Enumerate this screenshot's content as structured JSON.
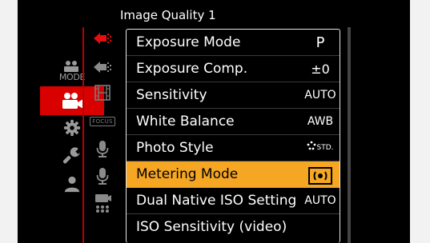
{
  "header": {
    "title": "Image Quality 1"
  },
  "main_menu": [
    {
      "id": "mode",
      "label": "MODE",
      "icon": "mode-icon",
      "selected": false
    },
    {
      "id": "video",
      "icon": "video-camera-icon",
      "selected": true
    },
    {
      "id": "custom",
      "icon": "gear-icon",
      "selected": false
    },
    {
      "id": "setup",
      "icon": "wrench-icon",
      "selected": false
    },
    {
      "id": "mymenu",
      "icon": "person-icon",
      "selected": false
    }
  ],
  "sub_tabs": [
    {
      "icon": "image-quality-tab-icon",
      "active": true
    },
    {
      "icon": "image-format-tab-icon",
      "active": false
    },
    {
      "icon": "film-strip-icon",
      "active": false
    },
    {
      "icon": "focus-tab-icon",
      "label": "FOCUS",
      "active": false
    },
    {
      "icon": "microphone-icon",
      "active": false
    },
    {
      "icon": "microphone-icon",
      "active": false
    },
    {
      "icon": "camera-tripod-icon",
      "active": false
    }
  ],
  "menu_items": [
    {
      "label": "Exposure Mode",
      "value": "P"
    },
    {
      "label": "Exposure Comp.",
      "value": "±0"
    },
    {
      "label": "Sensitivity",
      "value": "AUTO"
    },
    {
      "label": "White Balance",
      "value": "AWB"
    },
    {
      "label": "Photo Style",
      "value": "STD.",
      "value_icon": "photo-style-std-icon"
    },
    {
      "label": "Metering Mode",
      "value_icon": "metering-multiple-icon",
      "selected": true
    },
    {
      "label": "Dual Native ISO Setting",
      "value": "AUTO"
    },
    {
      "label": "ISO Sensitivity (video)"
    }
  ],
  "colors": {
    "selection_orange": "#f5a623",
    "video_red": "#d90000",
    "active_tab_red": "#e01010",
    "text_white": "#ffffff",
    "inactive_grey": "#9a9a9a"
  }
}
